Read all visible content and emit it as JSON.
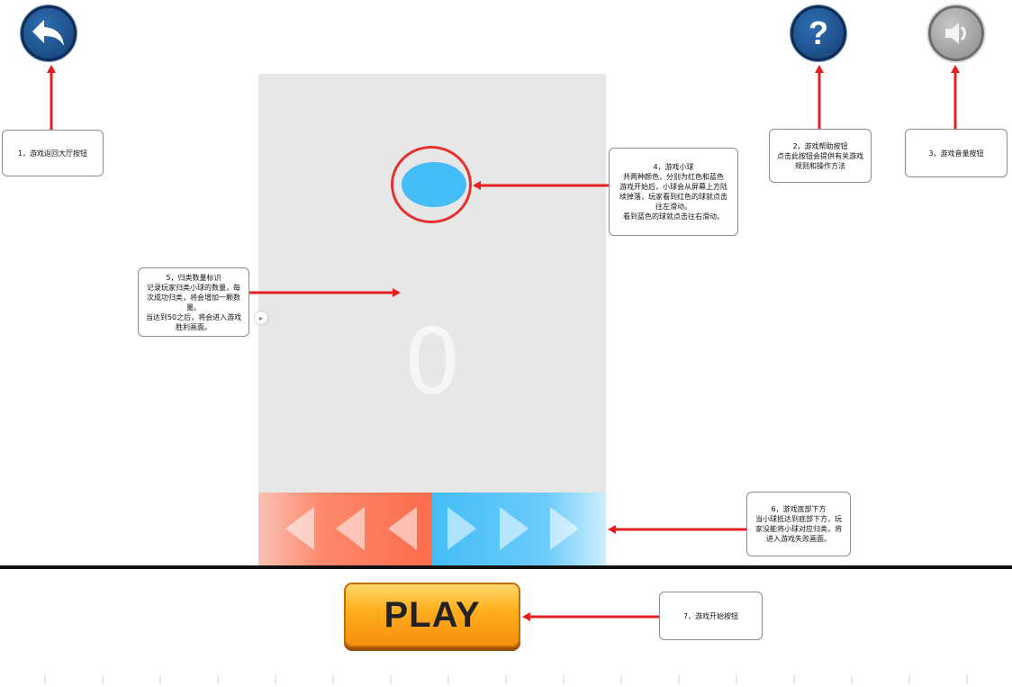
{
  "buttons": {
    "back": {
      "icon": "back-arrow-icon"
    },
    "help": {
      "icon": "question-mark-icon",
      "glyph": "?"
    },
    "sound": {
      "icon": "speaker-icon"
    },
    "play": {
      "label": "PLAY"
    }
  },
  "game": {
    "score": "0",
    "ball_color": "#44bdf7",
    "left_zone_color": "#fd6b4b",
    "right_zone_color": "#44bdf7"
  },
  "notes": {
    "back": "1，游戏返回大厅按钮",
    "help": [
      "2，游戏帮助按钮",
      "点击此按钮会提供有关游戏",
      "规则和操作方法"
    ],
    "sound": "3，游戏音量按钮",
    "ball": [
      "4，游戏小球",
      "共两种颜色，分别为红色和蓝色",
      "游戏开始后，小球会从屏幕上方陆",
      "续掉落，玩家看到红色的球就点击",
      "往左滑动。",
      "看到蓝色的球就点击往右滑动。"
    ],
    "count": [
      "5，归类数量标识",
      "记录玩家归类小球的数量，每",
      "次成功归类，将会增加一颗数",
      "量。",
      "当达到50之后，将会进入游戏",
      "胜利画面。"
    ],
    "bottom": [
      "6，游戏底部下方",
      "当小球抵达到底部下方，玩",
      "家没能将小球对应归类，将",
      "进入游戏失败画面。"
    ],
    "play": "7，游戏开始按钮"
  }
}
